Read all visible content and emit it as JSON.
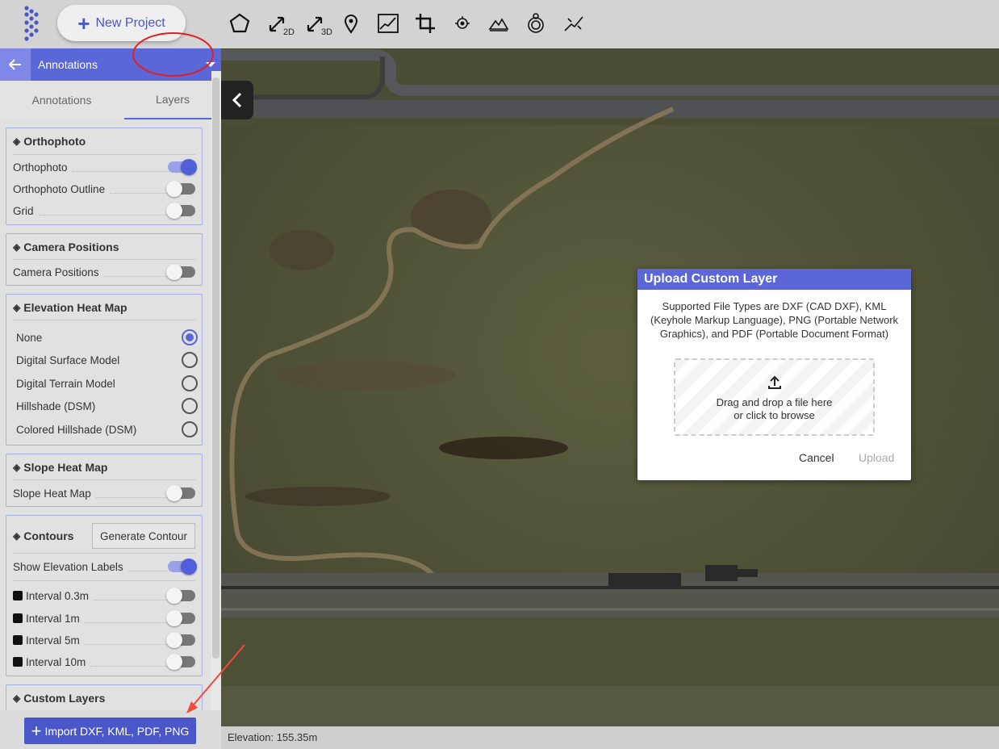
{
  "toolbar": {
    "new_project_label": "New Project",
    "tools": [
      {
        "icon": "polygon-icon"
      },
      {
        "icon": "measure-2d-icon",
        "sub": "2D"
      },
      {
        "icon": "measure-3d-icon",
        "sub": "3D"
      },
      {
        "icon": "marker-pin-icon"
      },
      {
        "icon": "elevation-profile-icon"
      },
      {
        "icon": "crop-icon"
      },
      {
        "icon": "camera-icon"
      },
      {
        "icon": "volume-icon"
      },
      {
        "icon": "target-icon"
      },
      {
        "icon": "stockpile-icon"
      }
    ]
  },
  "sidebar": {
    "header_title": "Annotations",
    "tabs": [
      "Annotations",
      "Layers"
    ],
    "active_tab": "Layers",
    "orthophoto": {
      "title": "Orthophoto",
      "items": [
        {
          "label": "Orthophoto",
          "on": true
        },
        {
          "label": "Orthophoto Outline",
          "on": false
        },
        {
          "label": "Grid",
          "on": false
        }
      ]
    },
    "camera": {
      "title": "Camera Positions",
      "items": [
        {
          "label": "Camera Positions",
          "on": false
        }
      ]
    },
    "elevation": {
      "title": "Elevation Heat Map",
      "options": [
        "None",
        "Digital Surface Model",
        "Digital Terrain Model",
        "Hillshade (DSM)",
        "Colored Hillshade (DSM)"
      ],
      "selected": "None"
    },
    "slope": {
      "title": "Slope Heat Map",
      "items": [
        {
          "label": "Slope Heat Map",
          "on": false
        }
      ]
    },
    "contours": {
      "title": "Contours",
      "generate_label": "Generate Contour",
      "show_labels": {
        "label": "Show Elevation Labels",
        "on": true
      },
      "intervals": [
        {
          "label": "Interval 0.3m",
          "on": false
        },
        {
          "label": "Interval 1m",
          "on": false
        },
        {
          "label": "Interval 5m",
          "on": false
        },
        {
          "label": "Interval 10m",
          "on": false
        }
      ]
    },
    "custom": {
      "title": "Custom Layers"
    },
    "import_label": "Import DXF, KML, PDF, PNG"
  },
  "map": {
    "elevation_readout": "Elevation: 155.35m"
  },
  "dialog": {
    "title": "Upload Custom Layer",
    "description": "Supported File Types are DXF (CAD DXF), KML (Keyhole Markup Language), PNG (Portable Network Graphics), and PDF (Portable Document Format)",
    "drop_line1": "Drag and drop a file here",
    "drop_line2": "or click to browse",
    "cancel_label": "Cancel",
    "upload_label": "Upload"
  },
  "colors": {
    "accent": "#5b67d6",
    "annotation_circle": "#e02020",
    "annotation_arrow": "#f04a3a"
  }
}
